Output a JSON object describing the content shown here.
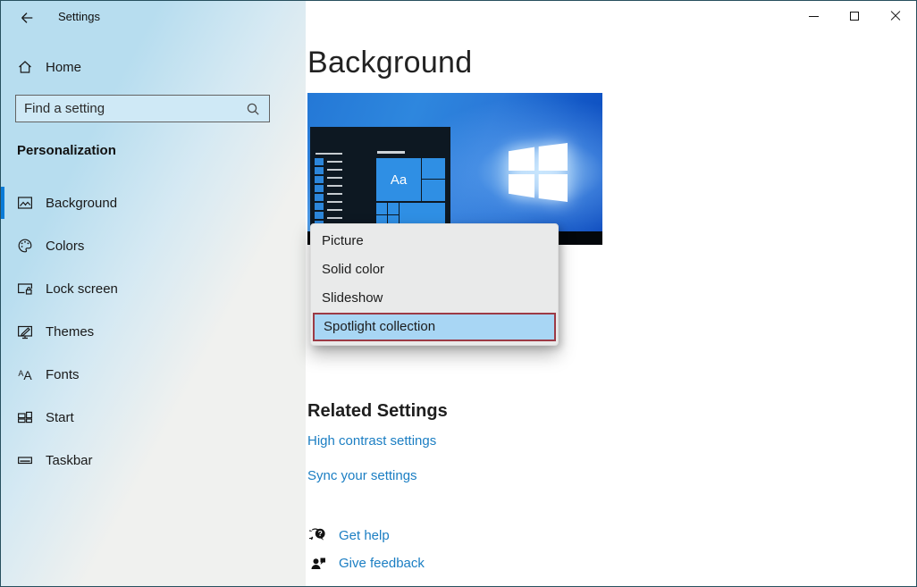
{
  "titlebar": {
    "app_title": "Settings"
  },
  "sidebar": {
    "home": {
      "label": "Home"
    },
    "search": {
      "placeholder": "Find a setting"
    },
    "section": {
      "heading": "Personalization"
    },
    "items": [
      {
        "label": "Background",
        "selected": true
      },
      {
        "label": "Colors",
        "selected": false
      },
      {
        "label": "Lock screen",
        "selected": false
      },
      {
        "label": "Themes",
        "selected": false
      },
      {
        "label": "Fonts",
        "selected": false
      },
      {
        "label": "Start",
        "selected": false
      },
      {
        "label": "Taskbar",
        "selected": false
      }
    ],
    "fonts_icon": {
      "small_letter": "A",
      "large_letter": "A"
    }
  },
  "main": {
    "page_title": "Background",
    "preview": {
      "tile_label": "Aa"
    },
    "dropdown": {
      "items": [
        {
          "label": "Picture",
          "highlighted": false
        },
        {
          "label": "Solid color",
          "highlighted": false
        },
        {
          "label": "Slideshow",
          "highlighted": false
        },
        {
          "label": "Spotlight collection",
          "highlighted": true
        }
      ]
    },
    "related_settings": {
      "heading": "Related Settings",
      "links": [
        {
          "label": "High contrast settings"
        },
        {
          "label": "Sync your settings"
        }
      ]
    },
    "help": {
      "question_mark": "?",
      "links": [
        {
          "label": "Get help"
        },
        {
          "label": "Give feedback"
        }
      ]
    }
  },
  "colors": {
    "accent": "#0a7bd7",
    "link_blue": "#1b7ec3",
    "dropdown_highlight": "#a8d6f4",
    "annotation_red": "#9c3a45",
    "sidebar_gradient_start": "#b7ddef",
    "sidebar_gradient_end": "#f0f1ef"
  }
}
